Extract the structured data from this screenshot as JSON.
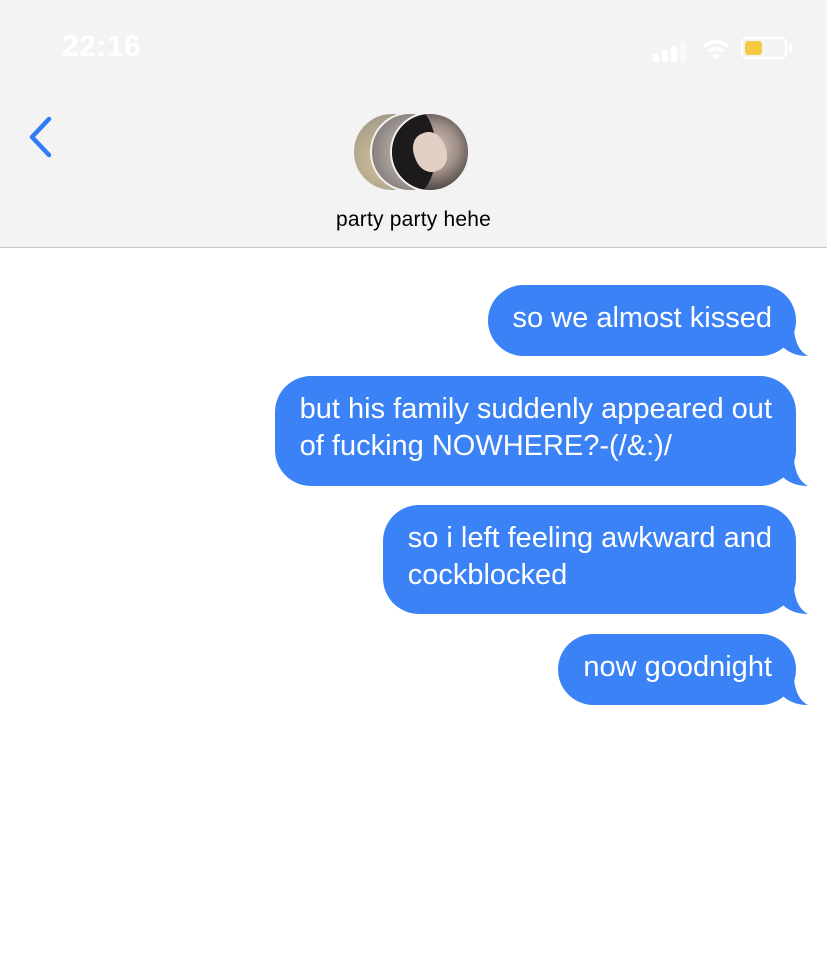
{
  "status_bar": {
    "time": "22:16",
    "battery_color": "#f5c944",
    "battery_level": 0.45
  },
  "header": {
    "back_icon": "chevron-left-icon",
    "title": "party party hehe",
    "accent_color": "#2f7cf6"
  },
  "messages": [
    {
      "lines": [
        "so we almost kissed"
      ]
    },
    {
      "lines": [
        "but his family suddenly appeared out",
        "of fucking NOWHERE?-(/&:)/"
      ]
    },
    {
      "lines": [
        "so i left feeling awkward and",
        "cockblocked"
      ]
    },
    {
      "lines": [
        "now goodnight"
      ]
    }
  ],
  "bubble_color": "#3b82f6"
}
